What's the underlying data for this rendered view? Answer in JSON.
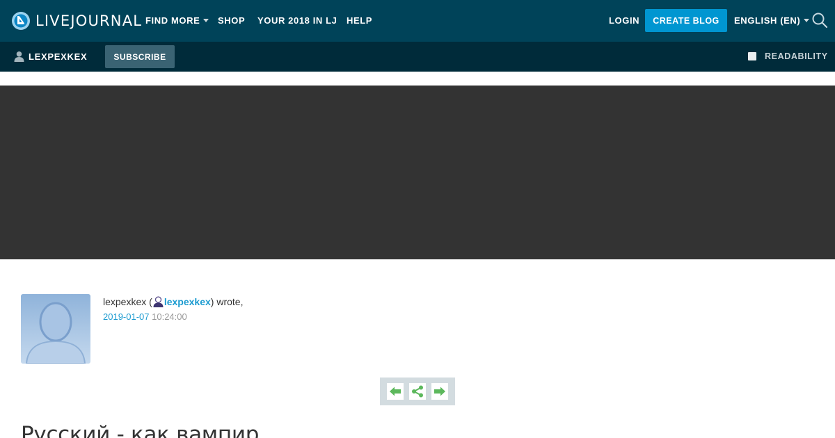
{
  "header": {
    "logo_text": "LIVEJOURNAL",
    "nav": {
      "find_more": "FIND MORE",
      "shop": "SHOP",
      "your_2018": "YOUR 2018 IN LJ",
      "help": "HELP"
    },
    "login": "LOGIN",
    "create_blog": "CREATE BLOG",
    "language": "ENGLISH (EN)"
  },
  "subnav": {
    "username": "LEXPEXKEX",
    "subscribe": "SUBSCRIBE",
    "readability": "READABILITY"
  },
  "entry": {
    "author_name": "lexpexkex",
    "author_user": "lexpexkex",
    "wrote": ") wrote,",
    "date": "2019-01-07",
    "time": "10:24:00",
    "title": "Русский - как вампир"
  },
  "colors": {
    "topnav_bg": "#004359",
    "subnav_bg": "#002b3a",
    "accent": "#0096d1",
    "link": "#1c9bd0",
    "banner": "#333333",
    "nav_arrows": "#5cb85c"
  }
}
